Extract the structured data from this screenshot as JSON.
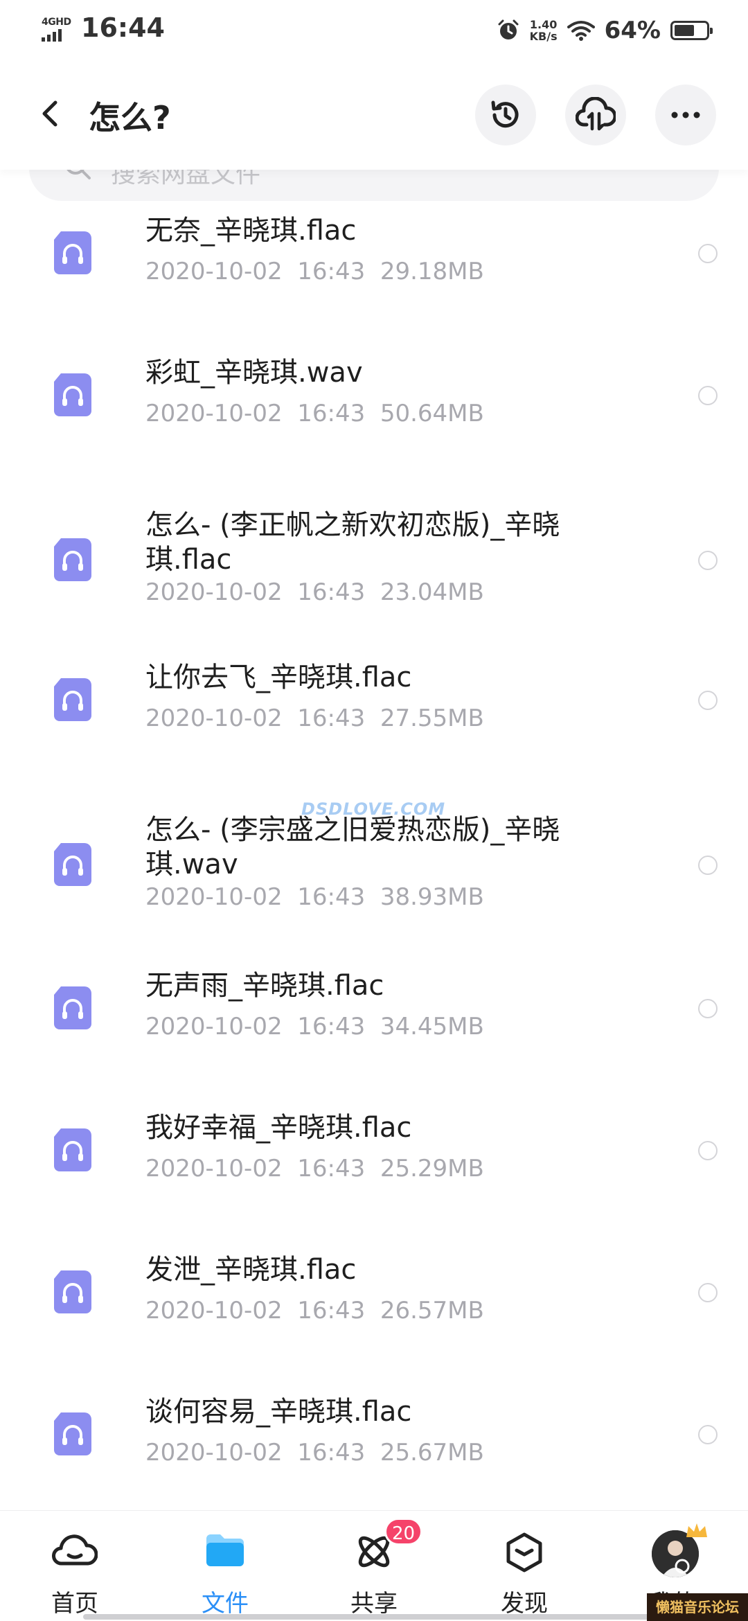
{
  "status_bar": {
    "network": "4GHD",
    "time": "16:44",
    "speed_value": "1.40",
    "speed_unit": "KB/s",
    "battery": "64%",
    "battery_level": 0.64
  },
  "header": {
    "title": "怎么?",
    "buttons": [
      "history-icon",
      "cloud-transfer-icon",
      "more-icon"
    ]
  },
  "search": {
    "placeholder": "搜索网盘文件"
  },
  "files": [
    {
      "name": "无奈_辛晓琪.flac",
      "date": "2020-10-02",
      "time": "16:43",
      "size": "29.18MB"
    },
    {
      "name": "彩虹_辛晓琪.wav",
      "date": "2020-10-02",
      "time": "16:43",
      "size": "50.64MB"
    },
    {
      "name": "怎么- (李正帆之新欢初恋版)_辛晓琪.flac",
      "date": "2020-10-02",
      "time": "16:43",
      "size": "23.04MB"
    },
    {
      "name": "让你去飞_辛晓琪.flac",
      "date": "2020-10-02",
      "time": "16:43",
      "size": "27.55MB"
    },
    {
      "name": "怎么- (李宗盛之旧爱热恋版)_辛晓琪.wav",
      "date": "2020-10-02",
      "time": "16:43",
      "size": "38.93MB"
    },
    {
      "name": "无声雨_辛晓琪.flac",
      "date": "2020-10-02",
      "time": "16:43",
      "size": "34.45MB"
    },
    {
      "name": "我好幸福_辛晓琪.flac",
      "date": "2020-10-02",
      "time": "16:43",
      "size": "25.29MB"
    },
    {
      "name": "发泄_辛晓琪.flac",
      "date": "2020-10-02",
      "time": "16:43",
      "size": "26.57MB"
    },
    {
      "name": "谈何容易_辛晓琪.flac",
      "date": "2020-10-02",
      "time": "16:43",
      "size": "25.67MB"
    }
  ],
  "watermark": "DSDLOVE.COM",
  "bottom_nav": {
    "tabs": [
      {
        "label": "首页",
        "icon": "home-cloud-icon"
      },
      {
        "label": "文件",
        "icon": "folder-icon",
        "active": true
      },
      {
        "label": "共享",
        "icon": "share-orbit-icon",
        "badge": "20"
      },
      {
        "label": "发现",
        "icon": "discover-icon"
      },
      {
        "label": "我的",
        "icon": "avatar"
      }
    ]
  },
  "forum_stamp": "懒猫音乐论坛",
  "colors": {
    "accent": "#2a8ff7",
    "file_icon": "#8c8df0",
    "badge": "#f5436a"
  }
}
